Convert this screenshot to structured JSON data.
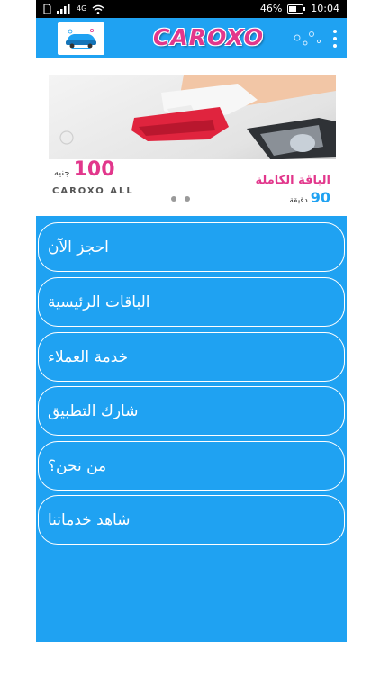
{
  "status_bar": {
    "network": "4G",
    "battery": "46%",
    "time": "10:04"
  },
  "app_bar": {
    "brand": "CAROXO"
  },
  "banner": {
    "price_value": "100",
    "price_unit": "جنيه",
    "brand_line": "CAROXO ALL",
    "package_title": "الباقة الكاملة",
    "duration_value": "90",
    "duration_unit": "دقيقة",
    "slides": 2,
    "active_slide": 1
  },
  "menu": {
    "items": [
      {
        "label": "احجز الآن"
      },
      {
        "label": "الباقات الرئيسية"
      },
      {
        "label": "خدمة العملاء"
      },
      {
        "label": "شارك التطبيق"
      },
      {
        "label": "من نحن؟"
      },
      {
        "label": "شاهد خدماتنا"
      }
    ]
  },
  "colors": {
    "primary": "#1fa2f2",
    "accent": "#e2378c",
    "button_border": "#ffffff"
  },
  "icons": {
    "signal": "signal-icon",
    "wifi": "wifi-icon",
    "sim": "sim-icon",
    "battery": "battery-icon",
    "menu": "more-vertical-icon",
    "logo": "car-wash-logo-icon"
  }
}
